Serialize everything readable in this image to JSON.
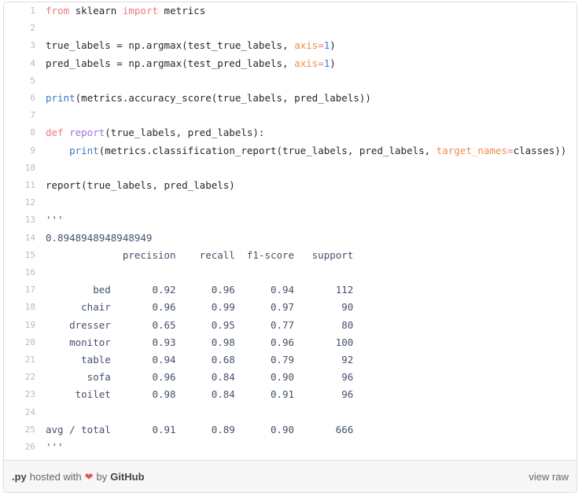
{
  "gist": {
    "language_ext": ".py",
    "hosted_with_text": "hosted with",
    "heart_icon": "heart-icon",
    "by_text": "by",
    "host_name": "GitHub",
    "view_raw_label": "view raw"
  },
  "colors": {
    "keyword": "#f2777a",
    "function": "#a071d8",
    "builtin": "#4078c0",
    "param": "#f08d49",
    "number": "#3b78e7",
    "string": "#45526b",
    "plain": "#24292e",
    "gutter": "#babbbc",
    "border": "#dddddd",
    "footer_bg": "#f7f7f7",
    "heart": "#e25555"
  },
  "code": {
    "line_numbers": [
      1,
      2,
      3,
      4,
      5,
      6,
      7,
      8,
      9,
      10,
      11,
      12,
      13,
      14,
      15,
      16,
      17,
      18,
      19,
      20,
      21,
      22,
      23,
      24,
      25,
      26
    ],
    "lines": [
      {
        "n": "1",
        "tokens": [
          {
            "t": "from",
            "c": "kw"
          },
          {
            "t": " ",
            "c": "plain"
          },
          {
            "t": "sklearn",
            "c": "plain"
          },
          {
            "t": " ",
            "c": "plain"
          },
          {
            "t": "import",
            "c": "kw"
          },
          {
            "t": " ",
            "c": "plain"
          },
          {
            "t": "metrics",
            "c": "plain"
          }
        ]
      },
      {
        "n": "2",
        "tokens": []
      },
      {
        "n": "3",
        "tokens": [
          {
            "t": "true_labels = np.argmax(test_true_labels, ",
            "c": "plain"
          },
          {
            "t": "axis",
            "c": "param"
          },
          {
            "t": "=",
            "c": "kw"
          },
          {
            "t": "1",
            "c": "num"
          },
          {
            "t": ")",
            "c": "plain"
          }
        ]
      },
      {
        "n": "4",
        "tokens": [
          {
            "t": "pred_labels = np.argmax(test_pred_labels, ",
            "c": "plain"
          },
          {
            "t": "axis",
            "c": "param"
          },
          {
            "t": "=",
            "c": "kw"
          },
          {
            "t": "1",
            "c": "num"
          },
          {
            "t": ")",
            "c": "plain"
          }
        ]
      },
      {
        "n": "5",
        "tokens": []
      },
      {
        "n": "6",
        "tokens": [
          {
            "t": "print",
            "c": "builtin"
          },
          {
            "t": "(metrics.accuracy_score(true_labels, pred_labels))",
            "c": "plain"
          }
        ]
      },
      {
        "n": "7",
        "tokens": []
      },
      {
        "n": "8",
        "tokens": [
          {
            "t": "def",
            "c": "kw"
          },
          {
            "t": " ",
            "c": "plain"
          },
          {
            "t": "report",
            "c": "fn"
          },
          {
            "t": "(true_labels, pred_labels):",
            "c": "plain"
          }
        ]
      },
      {
        "n": "9",
        "tokens": [
          {
            "t": "    ",
            "c": "plain"
          },
          {
            "t": "print",
            "c": "builtin"
          },
          {
            "t": "(metrics.classification_report(true_labels, pred_labels, ",
            "c": "plain"
          },
          {
            "t": "target_names",
            "c": "param"
          },
          {
            "t": "=",
            "c": "kw"
          },
          {
            "t": "classes))",
            "c": "plain"
          }
        ]
      },
      {
        "n": "10",
        "tokens": []
      },
      {
        "n": "11",
        "tokens": [
          {
            "t": "report(true_labels, pred_labels)",
            "c": "plain"
          }
        ]
      },
      {
        "n": "12",
        "tokens": []
      },
      {
        "n": "13",
        "tokens": [
          {
            "t": "'''",
            "c": "str"
          }
        ]
      },
      {
        "n": "14",
        "tokens": [
          {
            "t": "0.8948948948948949",
            "c": "str"
          }
        ]
      },
      {
        "n": "15",
        "tokens": [
          {
            "t": "             precision    recall  f1-score   support",
            "c": "str"
          }
        ]
      },
      {
        "n": "16",
        "tokens": []
      },
      {
        "n": "17",
        "tokens": [
          {
            "t": "        bed       0.92      0.96      0.94       112",
            "c": "str"
          }
        ]
      },
      {
        "n": "18",
        "tokens": [
          {
            "t": "      chair       0.96      0.99      0.97        90",
            "c": "str"
          }
        ]
      },
      {
        "n": "19",
        "tokens": [
          {
            "t": "    dresser       0.65      0.95      0.77        80",
            "c": "str"
          }
        ]
      },
      {
        "n": "20",
        "tokens": [
          {
            "t": "    monitor       0.93      0.98      0.96       100",
            "c": "str"
          }
        ]
      },
      {
        "n": "21",
        "tokens": [
          {
            "t": "      table       0.94      0.68      0.79        92",
            "c": "str"
          }
        ]
      },
      {
        "n": "22",
        "tokens": [
          {
            "t": "       sofa       0.96      0.84      0.90        96",
            "c": "str"
          }
        ]
      },
      {
        "n": "23",
        "tokens": [
          {
            "t": "     toilet       0.98      0.84      0.91        96",
            "c": "str"
          }
        ]
      },
      {
        "n": "24",
        "tokens": []
      },
      {
        "n": "25",
        "tokens": [
          {
            "t": "avg / total       0.91      0.89      0.90       666",
            "c": "str"
          }
        ]
      },
      {
        "n": "26",
        "tokens": [
          {
            "t": "'''",
            "c": "str"
          }
        ]
      }
    ]
  },
  "report_table": {
    "accuracy": "0.8948948948948949",
    "columns": [
      "",
      "precision",
      "recall",
      "f1-score",
      "support"
    ],
    "rows": [
      {
        "label": "bed",
        "precision": "0.92",
        "recall": "0.96",
        "f1_score": "0.94",
        "support": "112"
      },
      {
        "label": "chair",
        "precision": "0.96",
        "recall": "0.99",
        "f1_score": "0.97",
        "support": "90"
      },
      {
        "label": "dresser",
        "precision": "0.65",
        "recall": "0.95",
        "f1_score": "0.77",
        "support": "80"
      },
      {
        "label": "monitor",
        "precision": "0.93",
        "recall": "0.98",
        "f1_score": "0.96",
        "support": "100"
      },
      {
        "label": "table",
        "precision": "0.94",
        "recall": "0.68",
        "f1_score": "0.79",
        "support": "92"
      },
      {
        "label": "sofa",
        "precision": "0.96",
        "recall": "0.84",
        "f1_score": "0.90",
        "support": "96"
      },
      {
        "label": "toilet",
        "precision": "0.98",
        "recall": "0.84",
        "f1_score": "0.91",
        "support": "96"
      },
      {
        "label": "avg / total",
        "precision": "0.91",
        "recall": "0.89",
        "f1_score": "0.90",
        "support": "666"
      }
    ]
  }
}
